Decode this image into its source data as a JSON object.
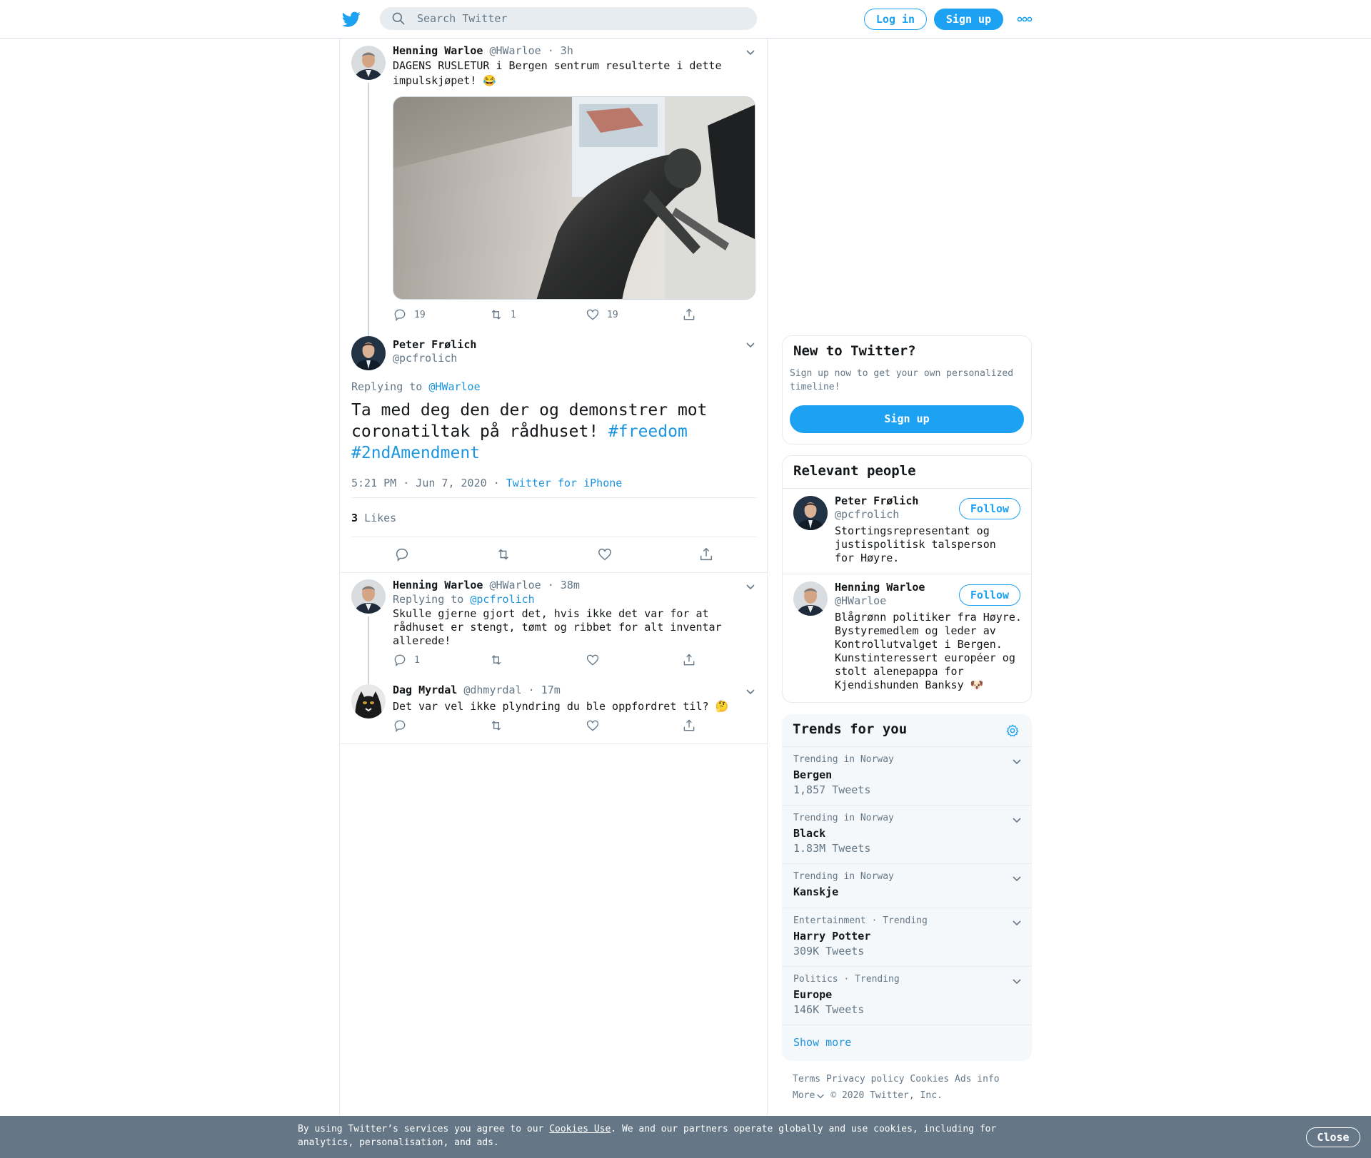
{
  "header": {
    "search_placeholder": "Search Twitter",
    "login_label": "Log in",
    "signup_label": "Sign up"
  },
  "tweets": {
    "parent": {
      "name": "Henning Warloe",
      "handle": "@HWarloe",
      "time": "· 3h",
      "text": "DAGENS RUSLETUR i Bergen sentrum resulterte i dette impulskjøpet! 😂",
      "replies": "19",
      "retweets": "1",
      "likes": "19"
    },
    "main": {
      "name": "Peter Frølich",
      "handle": "@pcfrolich",
      "replying_prefix": "Replying to",
      "replying_to": "@HWarloe",
      "text": "Ta med deg den der og demonstrer mot coronatiltak på rådhuset!",
      "hashtag1": "#freedom",
      "hashtag2": "#2ndAmendment",
      "timestamp": "5:21 PM · Jun 7, 2020",
      "sep": "·",
      "source": "Twitter for iPhone",
      "likes_count": "3",
      "likes_label": "Likes"
    },
    "reply1": {
      "name": "Henning Warloe",
      "handle": "@HWarloe",
      "time": "· 38m",
      "replying_prefix": "Replying to",
      "replying_to": "@pcfrolich",
      "text": "Skulle gjerne gjort det, hvis ikke det var for at rådhuset er stengt, tømt og ribbet for alt inventar allerede!",
      "replies": "1"
    },
    "reply2": {
      "name": "Dag Myrdal",
      "handle": "@dhmyrdal",
      "time": "· 17m",
      "text": "Det var vel ikke plyndring du ble oppfordret til? 🤔"
    }
  },
  "sidebar": {
    "new_to_twitter": {
      "title": "New to Twitter?",
      "desc": "Sign up now to get your own personalized timeline!",
      "button": "Sign up"
    },
    "relevant_people": {
      "title": "Relevant people",
      "people": [
        {
          "name": "Peter Frølich",
          "handle": "@pcfrolich",
          "bio": "Stortingsrepresentant og justispolitisk talsperson for Høyre.",
          "follow": "Follow"
        },
        {
          "name": "Henning Warloe",
          "handle": "@HWarloe",
          "bio": "Blågrønn politiker fra Høyre. Bystyremedlem og leder av Kontrollutvalget i Bergen. Kunstinteressert européer og stolt alenepappa for Kjendishunden Banksy 🐶",
          "follow": "Follow"
        }
      ]
    },
    "trends": {
      "title": "Trends for you",
      "items": [
        {
          "context": "Trending in Norway",
          "name": "Bergen",
          "count": "1,857 Tweets"
        },
        {
          "context": "Trending in Norway",
          "name": "Black",
          "count": "1.83M Tweets"
        },
        {
          "context": "Trending in Norway",
          "name": "Kanskje",
          "count": ""
        },
        {
          "context": "Entertainment · Trending",
          "name": "Harry Potter",
          "count": "309K Tweets"
        },
        {
          "context": "Politics · Trending",
          "name": "Europe",
          "count": "146K Tweets"
        }
      ],
      "show_more": "Show more"
    },
    "footer": {
      "links": [
        "Terms",
        "Privacy policy",
        "Cookies",
        "Ads info"
      ],
      "more": "More",
      "copyright": "© 2020 Twitter, Inc."
    }
  },
  "cookie_bar": {
    "text_before": "By using Twitter’s services you agree to our",
    "link": "Cookies Use",
    "text_after": ". We and our partners operate globally and use cookies, including for analytics, personalisation, and ads.",
    "close": "Close"
  },
  "colors": {
    "accent": "#1da1f2",
    "link": "#1b95e0",
    "muted": "#657786",
    "cookie_bg": "#657786"
  }
}
